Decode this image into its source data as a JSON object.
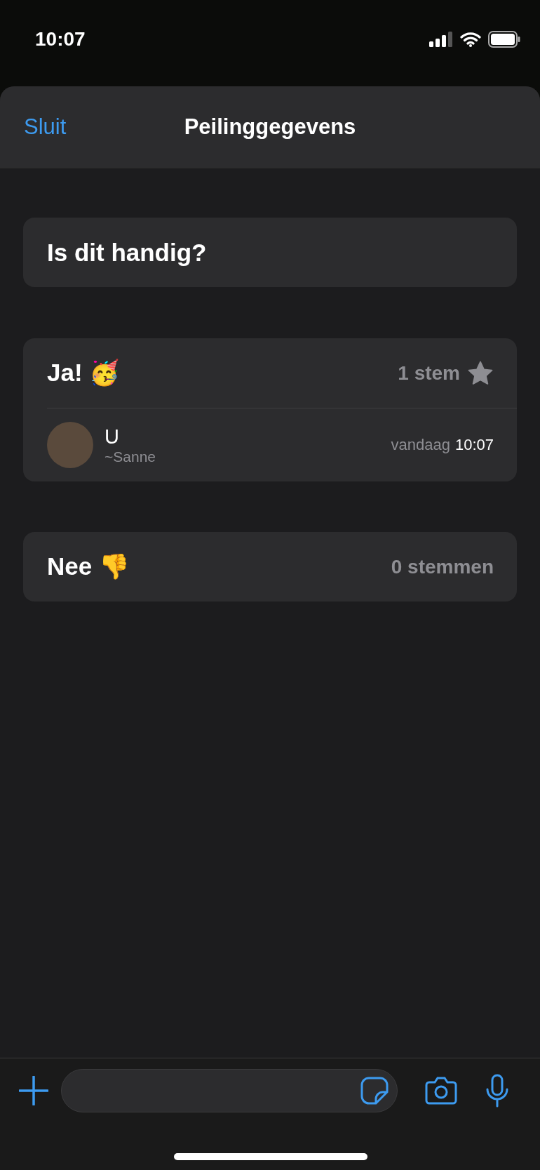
{
  "status_bar": {
    "time": "10:07"
  },
  "sheet": {
    "close_label": "Sluit",
    "title": "Peilinggegevens"
  },
  "question": "Is dit handig?",
  "options": [
    {
      "label": "Ja! 🥳",
      "count": "1 stem",
      "winner": true,
      "voters": [
        {
          "name": "U",
          "subname": "~Sanne",
          "day": "vandaag",
          "time": "10:07"
        }
      ]
    },
    {
      "label": "Nee 👎",
      "count": "0 stemmen",
      "winner": false
    }
  ]
}
